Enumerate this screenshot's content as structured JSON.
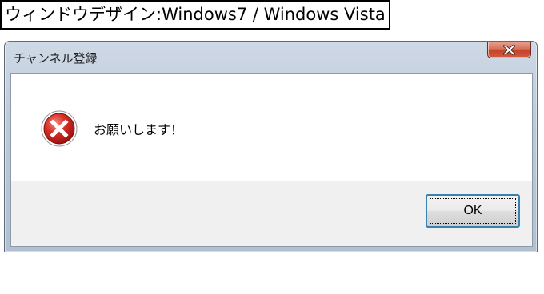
{
  "caption": "ウィンドウデザイン:Windows7 / Windows Vista",
  "window": {
    "title": "チャンネル登録",
    "close_icon": "close-icon"
  },
  "message": {
    "icon": "error-icon",
    "text": "お願いします！"
  },
  "buttons": {
    "ok_label": "OK"
  },
  "colors": {
    "close_button": "#c4442a",
    "error_icon": "#c8201c",
    "ok_border": "#3c7fb1"
  }
}
